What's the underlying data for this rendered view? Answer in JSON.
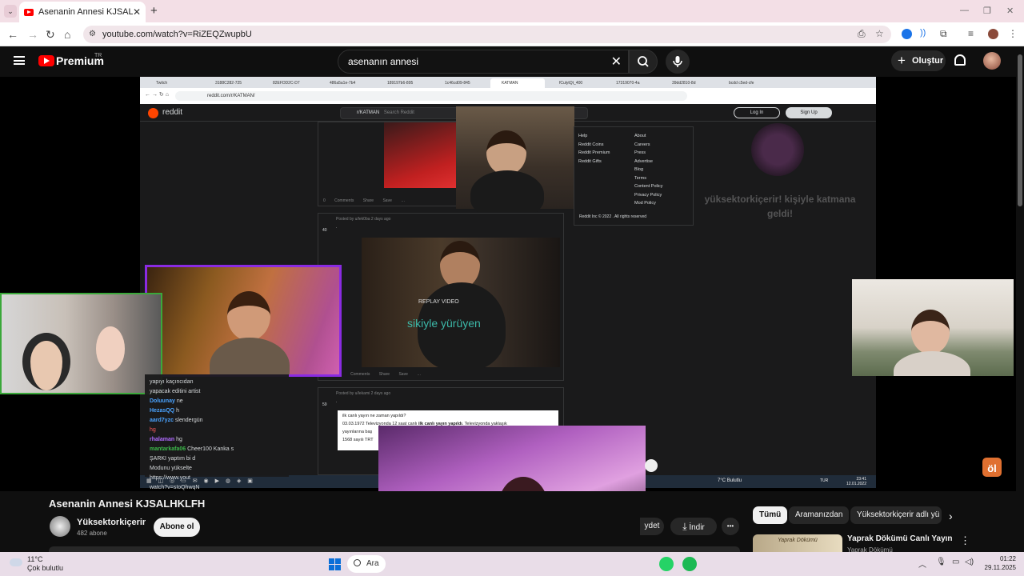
{
  "browser": {
    "tab_title": "Asenanin Annesi KJSALHKLFH - ",
    "url": "youtube.com/watch?v=RiZEQZwupbU"
  },
  "youtube": {
    "brand": "Premium",
    "region": "TR",
    "search_query": "asenanın annesi",
    "create_label": "Oluştur"
  },
  "video": {
    "title": "Asenanin Annesi KJSALHKLFH",
    "channel_name": "Yüksektorkiçerir",
    "subscribers": "482 abone",
    "subscribe_label": "Abone ol",
    "action_save_partial": "ydet",
    "download_label": "İndir",
    "more_label": "•••"
  },
  "chips": [
    "Tümü",
    "Aramanızdan",
    "Yüksektorkiçerir adlı yü"
  ],
  "recommendation": {
    "thumb_text": "Yaprak Dökümü",
    "title": "Yaprak Dökümü Canlı Yayın",
    "channel": "Yaprak Dökümü"
  },
  "inner_browser": {
    "tabs": [
      "Twitch",
      "3188C282-725",
      "82EFDD2C-D7",
      "486a5a1e-7b4",
      "189197b6-895",
      "1c46cd09-845",
      "KATMAN",
      "fCulytQt_400",
      "17319070-4a",
      "39dd2810-8d",
      "bcdd c5ed-cfe"
    ],
    "url": "reddit.com/r/KATMAN/",
    "reddit_word": "reddit",
    "subreddit": "r/KATMAN",
    "search_placeholder": "Search Reddit",
    "login": "Log In",
    "signup": "Sign Up",
    "post1_comments": "0 Comments",
    "post1_share": "Share",
    "post1_save": "Save",
    "post2_meta": "Posted by u/lek0ba 2 days ago",
    "post2_votes": "40",
    "post2_dot": ".",
    "replay": "REPLAY VIDEO",
    "caption": "sikiyle yürüyen",
    "post3_meta": "Posted by u/lekami 2 days ago",
    "post3_votes": "59",
    "post3_dot": ".",
    "post3_q": "ilk canlı yayın ne zaman yapıldı?",
    "post3_a1": "03.03.1972 Televizyonda 12 saat canlı ",
    "post3_a1b": "ilk canlı yayın yapıldı",
    "post3_a1c": ". Televizyonda yaklaşık",
    "post3_a2": "yayınlarına baş",
    "post3_a3": "1568 sayılı TRT",
    "footer_col1": [
      "Help",
      "Reddit Coins",
      "Reddit Premium",
      "Reddit Gifts"
    ],
    "footer_col2": [
      "About",
      "Careers",
      "Press",
      "Advertise",
      "Blog",
      "Terms",
      "Content Policy",
      "Privacy Policy",
      "Mod Policy"
    ],
    "footer_copy": "Reddit Inc © 2022 . All rights reserved",
    "overlay_text": "yüksektorkiçerir! kişiyle katmana geldi!",
    "taskbar_weather": "7°C Bulutlu",
    "taskbar_lang": "TUR",
    "taskbar_time": "23:41",
    "taskbar_date": "12.01.2022"
  },
  "chat": [
    {
      "user": "",
      "text": "yapıyı kaçıncıdan",
      "color": "#d7dadc"
    },
    {
      "user": "",
      "text": "yapacak editini artist",
      "color": "#d7dadc"
    },
    {
      "user": "Doluunay",
      "text": "ne",
      "color": "#4aa3ff"
    },
    {
      "user": "HezasQQ",
      "text": "h",
      "color": "#4aa3ff"
    },
    {
      "user": "aard7yzc",
      "text": "slendergün",
      "color": "#4aa3ff"
    },
    {
      "user": "",
      "text": "hg",
      "color": "#ff5a5a"
    },
    {
      "user": "rhalaman",
      "text": "hg",
      "color": "#b06cff"
    },
    {
      "user": "mantarkafa06",
      "text": "Cheer100 Kanka s",
      "color": "#3cb84a"
    },
    {
      "user": "",
      "text": "ŞARKI yaptım bi d",
      "color": "#d7dadc"
    },
    {
      "user": "",
      "text": "Modunu yükselte",
      "color": "#d7dadc"
    },
    {
      "user": "",
      "text": "https://www.yout",
      "color": "#d7dadc"
    },
    {
      "user": "",
      "text": "watch?v=sIoQhwqN",
      "color": "#d7dadc"
    }
  ],
  "taskbar": {
    "temp": "11°C",
    "weather": "Çok bulutlu",
    "search_label": "Ara",
    "time": "01:22",
    "date": "29.11.2025"
  },
  "corner_badge": "öl",
  "colors": {
    "youtube_red": "#ff0000",
    "reddit_orange": "#ff4500",
    "cam_purple_border": "#8a2be2",
    "cam_green_border": "#3aa83a"
  }
}
